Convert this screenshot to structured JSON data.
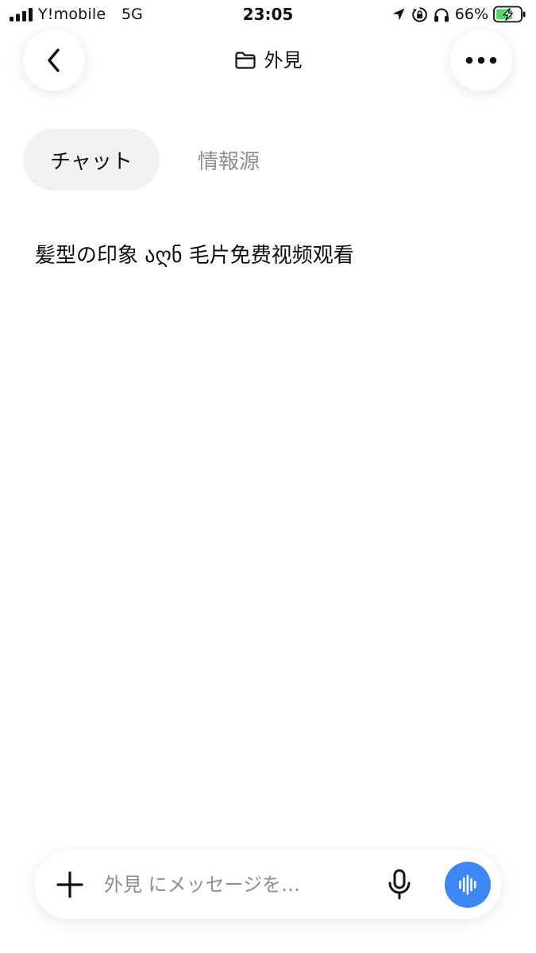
{
  "status_bar": {
    "carrier": "Y!mobile",
    "network": "5G",
    "time": "23:05",
    "battery_percent": "66%",
    "icons": [
      "signal-icon",
      "location-arrow-icon",
      "rotation-lock-icon",
      "headphones-icon",
      "battery-charging-icon"
    ]
  },
  "header": {
    "title": "外見",
    "back_icon": "chevron-left-icon",
    "folder_icon": "folder-icon",
    "more_icon": "ellipsis-icon"
  },
  "tabs": [
    {
      "label": "チャット",
      "selected": true
    },
    {
      "label": "情報源",
      "selected": false
    }
  ],
  "messages": [
    {
      "text": "髪型の印象  აღნ 毛片免费视频观看"
    }
  ],
  "composer": {
    "placeholder": "外見 にメッセージを…",
    "value": "",
    "plus_icon": "plus-icon",
    "mic_icon": "microphone-icon",
    "voice_icon": "voice-waveform-icon"
  },
  "colors": {
    "background": "#ffffff",
    "text_primary": "#111111",
    "text_secondary": "#8e8e8e",
    "tab_selected_bg": "#f1f1f1",
    "accent_blue": "#3d87f5",
    "battery_green": "#4cd964"
  }
}
